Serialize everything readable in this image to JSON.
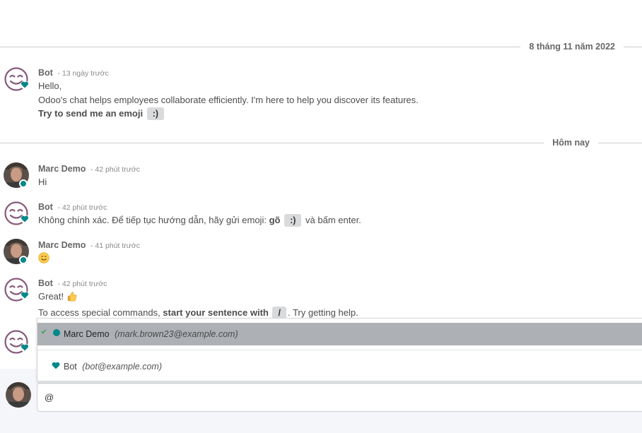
{
  "separators": [
    {
      "label": "8 tháng 11 năm 2022"
    },
    {
      "label": "Hôm nay"
    }
  ],
  "messages": [
    {
      "author": "Bot",
      "when": "- 13 ngày trước",
      "lines": {
        "l1": "Hello,",
        "l2": "Odoo's chat helps employees collaborate efficiently. I'm here to help you discover its features.",
        "l3_bold": "Try to send me an emoji",
        "l3_kbd": ":)"
      }
    },
    {
      "author": "Marc Demo",
      "when": "- 42 phút trước",
      "text": "Hi"
    },
    {
      "author": "Bot",
      "when": "- 42 phút trước",
      "pre": "Không chính xác. Để tiếp tục hướng dẫn, hãy gửi emoji: ",
      "bold": "gõ",
      "kbd": ":)",
      "post": " và bấm enter."
    },
    {
      "author": "Marc Demo",
      "when": "- 41 phút trước",
      "emoji": "smiling-face-emoji"
    },
    {
      "author": "Bot",
      "when": "- 42 phút trước",
      "l1": "Great!",
      "l1_emoji": "thumbs-up-emoji",
      "l2_pre": "To access special commands, ",
      "l2_bold": "start your sentence with",
      "l2_kbd": "/",
      "l2_post": ". Try getting help."
    }
  ],
  "mention_suggestions": [
    {
      "name": "Marc Demo",
      "email": "(mark.brown23@example.com)",
      "icon": "online-dot-icon",
      "selected": true
    },
    {
      "name": "Bot",
      "email": "(bot@example.com)",
      "icon": "heart-icon",
      "selected": false
    }
  ],
  "composer": {
    "value": "@"
  },
  "colors": {
    "accent": "#01888a",
    "bot_face": "#875a7b",
    "selected_row": "#adb0b5"
  }
}
